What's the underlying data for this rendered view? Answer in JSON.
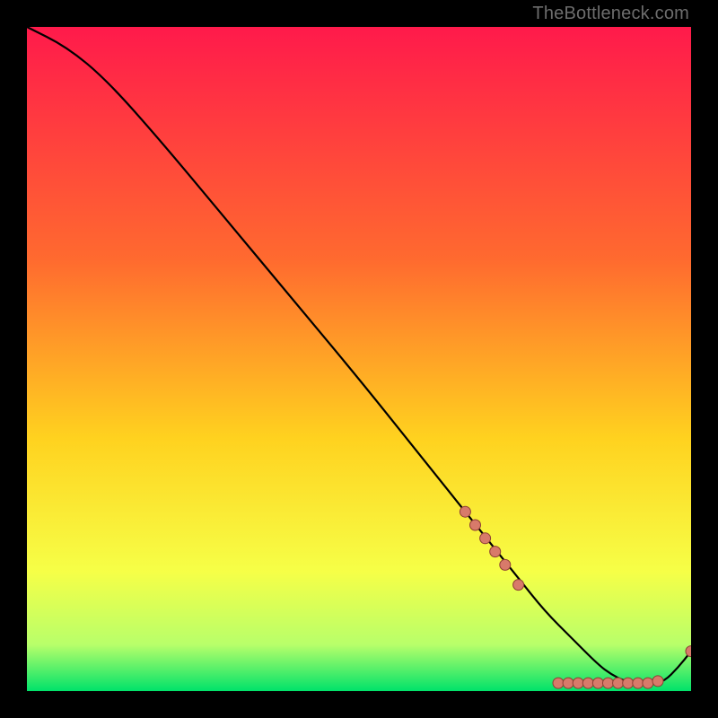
{
  "watermark": "TheBottleneck.com",
  "colors": {
    "grad_top": "#ff1a4b",
    "grad_mid1": "#ff6a2f",
    "grad_mid2": "#ffd21f",
    "grad_low1": "#f6ff47",
    "grad_low2": "#b8ff6a",
    "grad_bottom": "#00e26a",
    "curve_stroke": "#000000",
    "marker_fill": "#d87a6a",
    "marker_stroke": "#8d3e33",
    "background": "#000000"
  },
  "chart_data": {
    "type": "line",
    "title": "",
    "xlabel": "",
    "ylabel": "",
    "xlim": [
      0,
      100
    ],
    "ylim": [
      0,
      100
    ],
    "series": [
      {
        "name": "bottleneck-curve",
        "x": [
          0,
          6,
          12,
          20,
          30,
          40,
          50,
          58,
          62,
          66,
          70,
          74,
          78,
          82,
          86,
          88,
          90,
          92,
          94,
          96,
          98,
          100
        ],
        "y": [
          100,
          97,
          92,
          83,
          71,
          59,
          47,
          37,
          32,
          27,
          22,
          17,
          12,
          8,
          4,
          2.5,
          1.5,
          1,
          1,
          1.5,
          3.5,
          6
        ]
      }
    ],
    "markers": [
      {
        "x": 66,
        "y": 27
      },
      {
        "x": 67.5,
        "y": 25
      },
      {
        "x": 69,
        "y": 23
      },
      {
        "x": 70.5,
        "y": 21
      },
      {
        "x": 72,
        "y": 19
      },
      {
        "x": 74,
        "y": 16
      },
      {
        "x": 80,
        "y": 1.2
      },
      {
        "x": 81.5,
        "y": 1.2
      },
      {
        "x": 83,
        "y": 1.2
      },
      {
        "x": 84.5,
        "y": 1.2
      },
      {
        "x": 86,
        "y": 1.2
      },
      {
        "x": 87.5,
        "y": 1.2
      },
      {
        "x": 89,
        "y": 1.2
      },
      {
        "x": 90.5,
        "y": 1.2
      },
      {
        "x": 92,
        "y": 1.2
      },
      {
        "x": 93.5,
        "y": 1.2
      },
      {
        "x": 95,
        "y": 1.5
      },
      {
        "x": 100,
        "y": 6
      }
    ],
    "marker_label": {
      "text": "",
      "x": 83,
      "y": 3
    }
  }
}
